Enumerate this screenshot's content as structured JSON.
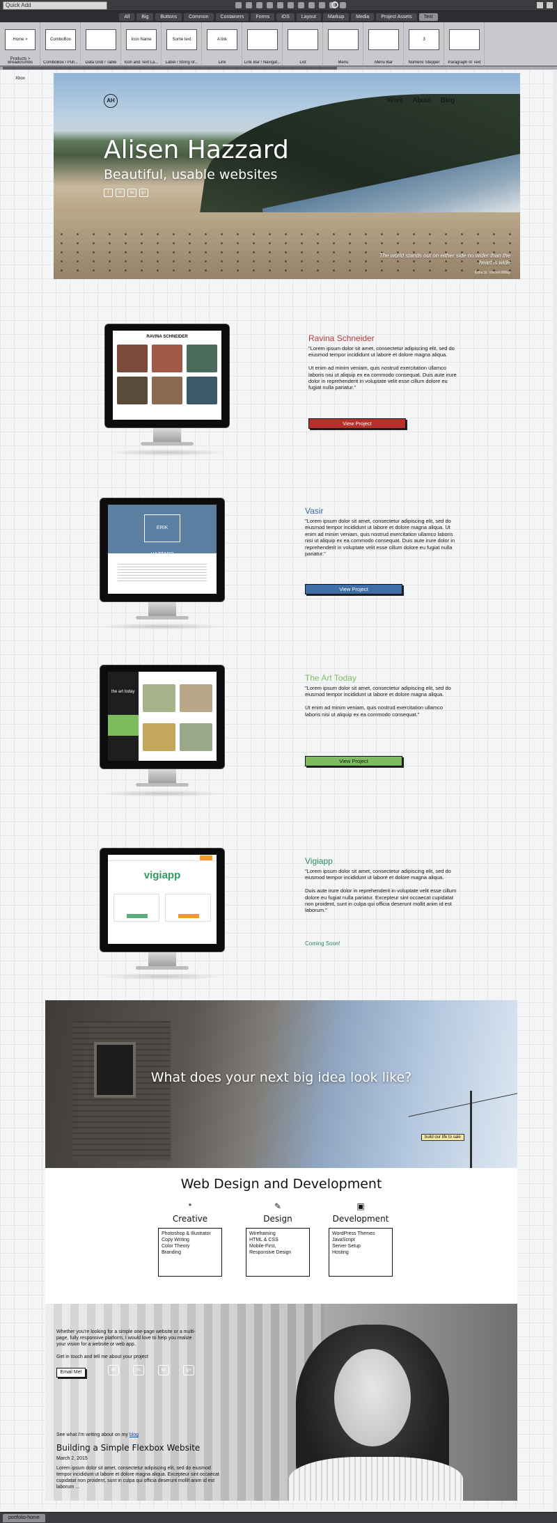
{
  "app": {
    "quick_add": "Quick Add",
    "categories": [
      "All",
      "Big",
      "Buttons",
      "Common",
      "Containers",
      "Forms",
      "iOS",
      "Layout",
      "Markup",
      "Media",
      "Project Assets",
      "Text"
    ],
    "active_category": "Text",
    "library": [
      "Breadcrumbs",
      "ComboBox / Pull...",
      "Data Grid / Table",
      "Icon and Text La...",
      "Label / String of...",
      "Link",
      "Link Bar / Navigat...",
      "List",
      "Menu",
      "Menu Bar",
      "Numeric Stepper",
      "Paragraph of Text"
    ],
    "library_previews": [
      "Home > Products > Xbox",
      "ComboBox",
      "",
      "Icon Name",
      "Some text",
      "A link",
      "",
      "",
      "",
      "",
      "3",
      ""
    ],
    "tab_label": "portfolio-home"
  },
  "hero": {
    "logo": "AH",
    "nav": [
      "Work",
      "About",
      "Blog"
    ],
    "name": "Alisen Hazzard",
    "tagline": "Beautiful, usable websites",
    "socials": [
      "f",
      "in",
      "tw",
      "g+"
    ],
    "quote": "The world stands out on either side no wider than the heart is wide",
    "credit": "Edna St. Vincent Millay"
  },
  "projects": [
    {
      "title": "Ravina Schneider",
      "color": "#b23a36",
      "text": "\"Lorem ipsum dolor sit amet, consectetur adipiscing elit, sed do eiusmod tempor incididunt ut labore et dolore magna aliqua.\n\nUt enim ad minim veniam, quis nostrud exercitation ullamco laboris nisi ut aliquip ex ea commodo consequat. Duis aute irure dolor in reprehenderit in voluptate velit esse cillum dolore eu fugiat nulla pariatur.\"",
      "button": "View Project",
      "btn_color": "#b8302c",
      "screen_heading": "RAVINA SCHNEIDER"
    },
    {
      "title": "Vasir",
      "color": "#3a6aa0",
      "text": "\"Lorem ipsum dolor sit amet, consectetur adipiscing elit, sed do eiusmod tempor incididunt ut labore et dolore magna aliqua. Ut enim ad minim veniam, quis nostrud exercitation ullamco laboris nisi ut aliquip ex ea commodo consequat. Duis aute irure dolor in reprehenderit in voluptate velit esse cillum dolore eu fugiat nulla pariatur.\"",
      "button": "View Project",
      "btn_color": "#3e6fa8",
      "screen_heading": "ERIK HAZZARD"
    },
    {
      "title": "The Art Today",
      "color": "#5aa04a",
      "text": "\"Lorem ipsum dolor sit amet, consectetur adipiscing elit, sed do eiusmod tempor incididunt ut labore et dolore magna aliqua.\n\nUt enim ad minim veniam, quis nostrud exercitation ullamco laboris nisi ut aliquip ex ea commodo consequat.\"",
      "button": "View Project",
      "btn_color": "#7dbd5f",
      "screen_heading": "the art today"
    },
    {
      "title": "Vigiapp",
      "color": "#2e8a5a",
      "text": "\"Lorem ipsum dolor sit amet, consectetur adipiscing elit, sed do eiusmod tempor incididunt ut labore et dolore magna aliqua.\n\nDuis aute irure dolor in reprehenderit in voluptate velit esse cillum dolore eu fugiat nulla pariatur. Excepteur sint occaecat cupidatat non proident, sunt in culpa qui officia deserunt mollit anim id est laborum.\"",
      "button": "",
      "status": "Coming Soon!",
      "screen_heading": "vigiapp"
    }
  ],
  "cta": {
    "headline": "What does your next big idea look like?",
    "sign": "build our life to sale"
  },
  "services": {
    "heading": "Web Design and Development",
    "columns": [
      {
        "icon": "*",
        "title": "Creative",
        "items": [
          "Photoshop & Illustrator",
          "Copy Writing",
          "Color Theory",
          "Branding"
        ]
      },
      {
        "icon": "✎",
        "title": "Design",
        "items": [
          "Wireframing",
          "HTML & CSS",
          "Mobile-First,",
          "Responsive Design"
        ]
      },
      {
        "icon": "▣",
        "title": "Development",
        "items": [
          "WordPress Themes",
          "JavaScript",
          "Server Setup",
          "Hosting"
        ]
      }
    ]
  },
  "contact": {
    "intro": "Whether you're looking for a simple one-page website or a multi-page, fully responsive platform, I would love to help you realize your vision for a website or web app.",
    "prompt": "Get in touch and tell me about your project",
    "email_button": "Email Me!",
    "socials": [
      "✉",
      "in",
      "tw",
      "g+"
    ],
    "blog_lead_text": "See what I'm writing about on my",
    "blog_link": "blog",
    "post_title": "Building a Simple Flexbox Website",
    "post_date": "March 2, 2015",
    "post_excerpt": "Lorem ipsum dolor sit amet, consectetur adipiscing elit, sed do eiusmod tempor incididunt ut labore et dolore magna aliqua. Excepteur sint occaecat cupidatat non proident, sunt in culpa qui officia deserunt mollit anim id est laborum ..."
  }
}
